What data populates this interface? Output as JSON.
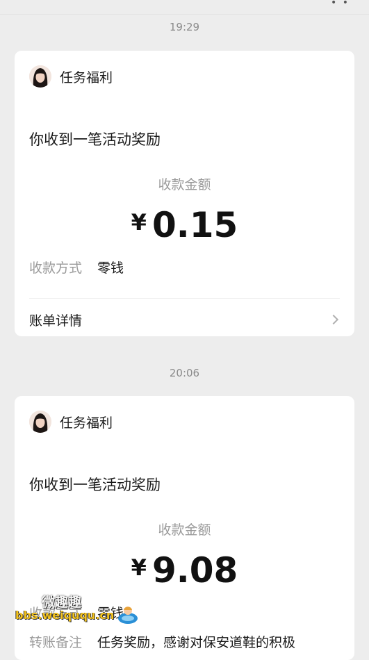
{
  "header": {
    "menu_icon": "more-icon"
  },
  "messages": [
    {
      "time": "19:29",
      "sender": "任务福利",
      "headline": "你收到一笔活动奖励",
      "amount_label": "收款金额",
      "currency": "¥",
      "amount": "0.15",
      "method_label": "收款方式",
      "method_value": "零钱",
      "detail_label": "账单详情"
    },
    {
      "time": "20:06",
      "sender": "任务福利",
      "headline": "你收到一笔活动奖励",
      "amount_label": "收款金额",
      "currency": "¥",
      "amount": "9.08",
      "method_label": "收款方式",
      "method_value": "零钱",
      "remark_label": "转账备注",
      "remark_value": "任务奖励，感谢对保安道鞋的积极"
    }
  ],
  "watermark": {
    "title": "微趣趣",
    "url": "bbs.weiququ.cn"
  }
}
